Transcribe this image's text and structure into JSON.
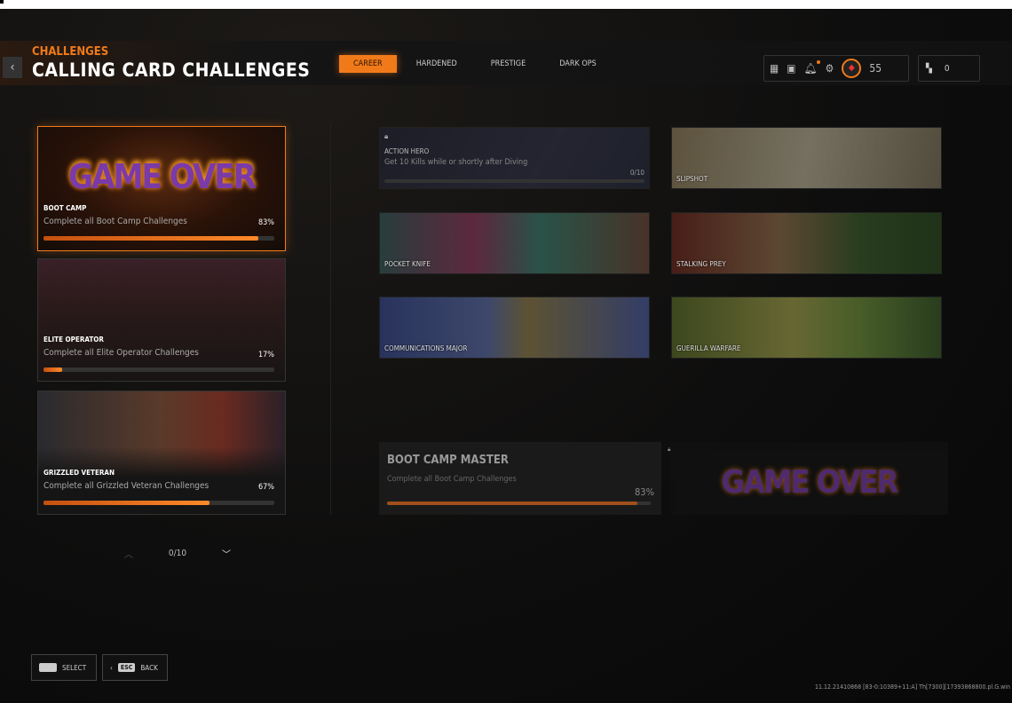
{
  "header": {
    "supertitle": "CHALLENGES",
    "title": "CALLING CARD CHALLENGES",
    "back_icon": "chevron-left-icon"
  },
  "tabs": [
    {
      "label": "CAREER",
      "active": true
    },
    {
      "label": "HARDENED"
    },
    {
      "label": "PRESTIGE"
    },
    {
      "label": "DARK OPS"
    }
  ],
  "hud": {
    "level": "55",
    "currency": "0"
  },
  "categories": [
    {
      "name": "BOOT CAMP",
      "desc": "Complete all Boot Camp Challenges",
      "pct": "83%",
      "progress": 0.83,
      "logo_text": "GAME OVER"
    },
    {
      "name": "ELITE OPERATOR",
      "desc": "Complete all Elite Operator Challenges",
      "pct": "17%",
      "progress": 0.08
    },
    {
      "name": "GRIZZLED VETERAN",
      "desc": "Complete all Grizzled Veteran Challenges",
      "pct": "67%",
      "progress": 0.72
    }
  ],
  "cards": [
    {
      "name": "ACTION HERO",
      "desc": "Get 10 Kills while or shortly after Diving",
      "progress_text": "0/10",
      "locked": true
    },
    {
      "name": "SLIPSHOT"
    },
    {
      "name": "POCKET KNIFE"
    },
    {
      "name": "STALKING PREY"
    },
    {
      "name": "COMMUNICATIONS MAJOR"
    },
    {
      "name": "GUERILLA WARFARE"
    }
  ],
  "master": {
    "name": "BOOT CAMP MASTER",
    "desc": "Complete all Boot Camp Challenges",
    "pct": "83%",
    "progress": 0.95,
    "logo_text": "GAME OVER"
  },
  "pager": {
    "text": "0/10"
  },
  "footer": {
    "select": "SELECT",
    "back": "BACK",
    "esc_key": "ESC",
    "version": "11.12.21410868 [83-0:10389+11:A] Th[7300][17393868800.pl.G.win"
  }
}
